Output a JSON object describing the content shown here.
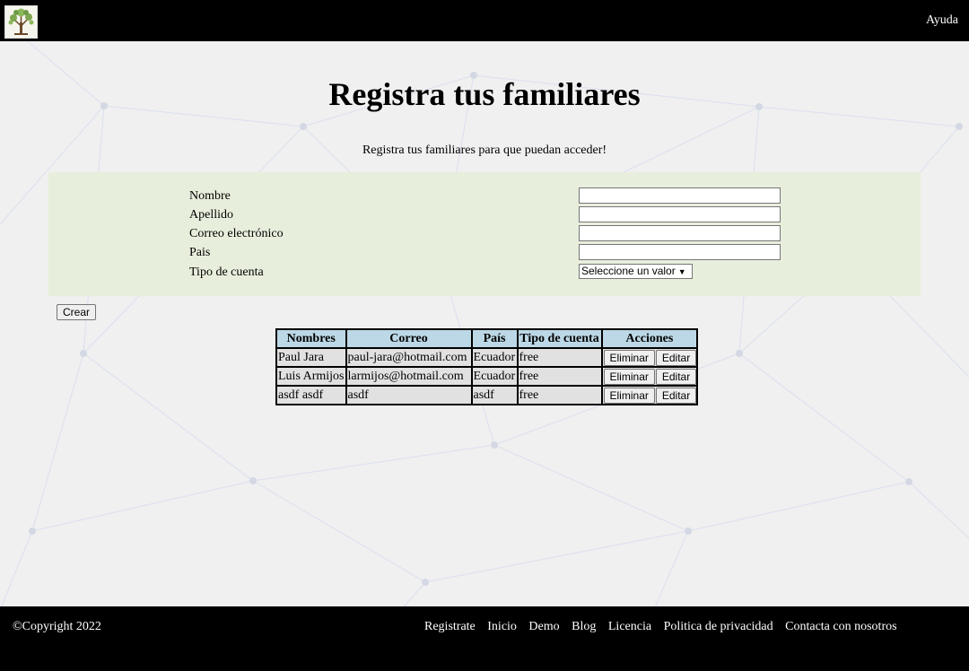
{
  "header": {
    "logo_icon": "tree-icon",
    "help_label": "Ayuda"
  },
  "main": {
    "title": "Registra tus familiares",
    "subtitle": "Registra tus familiares para que puedan acceder!"
  },
  "form": {
    "fields": [
      {
        "label": "Nombre",
        "value": ""
      },
      {
        "label": "Apellido",
        "value": ""
      },
      {
        "label": "Correo electrónico",
        "value": ""
      },
      {
        "label": "Pais",
        "value": ""
      }
    ],
    "account_type": {
      "label": "Tipo de cuenta",
      "selected": "Seleccione un valor"
    },
    "create_label": "Crear"
  },
  "table": {
    "headers": [
      "Nombres",
      "Correo",
      "País",
      "Tipo de cuenta",
      "Acciones"
    ],
    "delete_label": "Eliminar",
    "edit_label": "Editar",
    "rows": [
      {
        "name": "Paul Jara",
        "email": "paul-jara@hotmail.com",
        "country": "Ecuador",
        "type": "free"
      },
      {
        "name": "Luis Armijos",
        "email": "larmijos@hotmail.com",
        "country": "Ecuador",
        "type": "free"
      },
      {
        "name": "asdf asdf",
        "email": "asdf",
        "country": "asdf",
        "type": "free"
      }
    ]
  },
  "footer": {
    "copyright": "©Copyright 2022",
    "links": [
      "Registrate",
      "Inicio",
      "Demo",
      "Blog",
      "Licencia",
      "Politica de privacidad",
      "Contacta con nosotros"
    ]
  },
  "colors": {
    "header_bg": "#000000",
    "page_bg": "#eff0ef",
    "form_bg": "#e8eedc",
    "table_header_bg": "#bcd8e6",
    "table_body_bg": "#e1e1e1"
  }
}
